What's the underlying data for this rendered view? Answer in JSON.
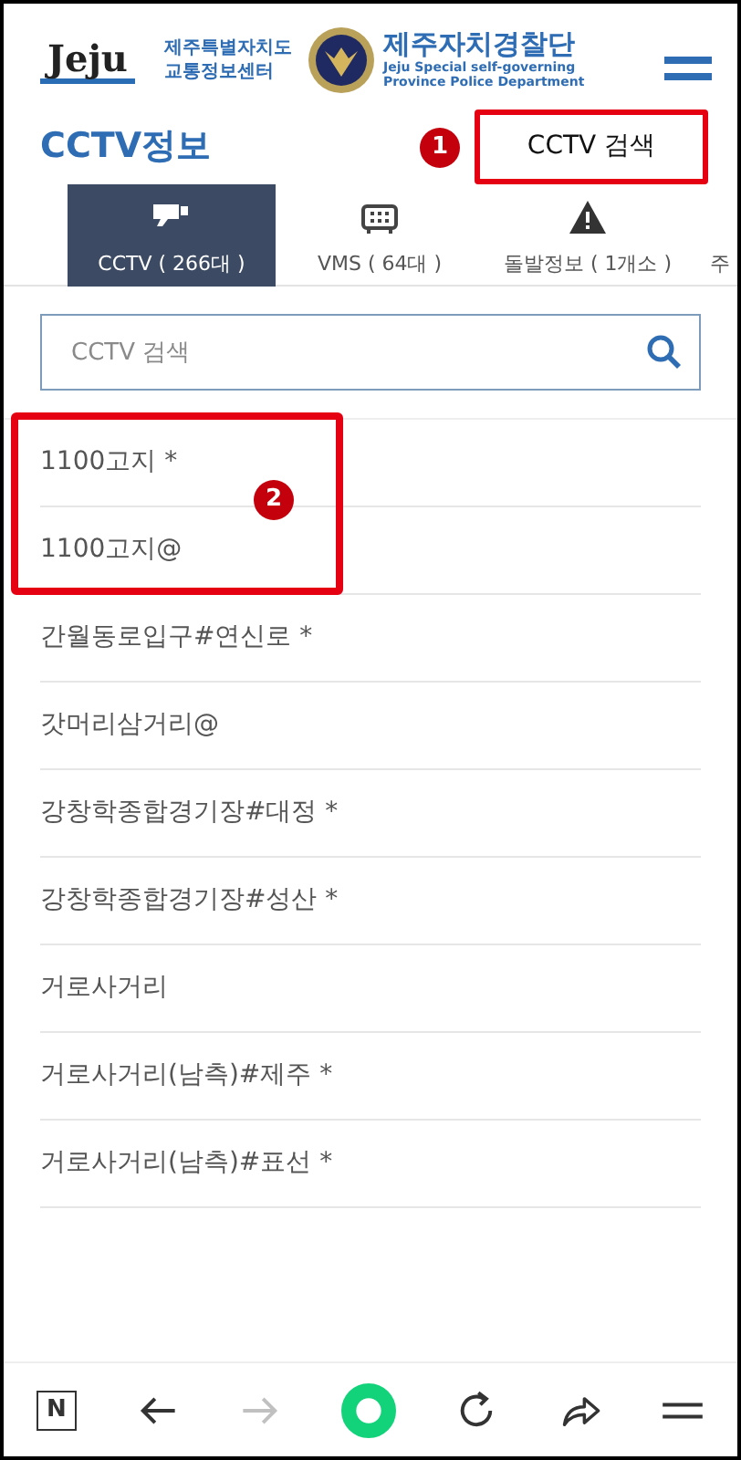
{
  "header": {
    "logo_text": "Jeju",
    "center_name": [
      "제주특별자치도",
      "교통정보센터"
    ],
    "police_name": "제주자치경찰단",
    "police_subtitle": [
      "Jeju Special self-governing",
      "Province Police Department"
    ]
  },
  "page_title": "CCTV정보",
  "search_button": {
    "label": "CCTV 검색",
    "callout": "1"
  },
  "tabs": [
    {
      "kind": "cctv",
      "label": "CCTV ( 266대 )",
      "selected": true
    },
    {
      "kind": "vms",
      "label": "VMS ( 64대 )",
      "selected": false
    },
    {
      "kind": "incident",
      "label": "돌발정보 ( 1개소 )",
      "selected": false
    },
    {
      "kind": "plain",
      "label": "주",
      "selected": false
    }
  ],
  "search": {
    "placeholder": "CCTV 검색"
  },
  "list_callout": "2",
  "cctv_list": [
    "1100고지 *",
    "1100고지@",
    "간월동로입구#연신로 *",
    "갓머리삼거리@",
    "강창학종합경기장#대정 *",
    "강창학종합경기장#성산 *",
    "거로사거리",
    "거로사거리(남측)#제주 *",
    "거로사거리(남측)#표선 *"
  ],
  "browser_bar": [
    {
      "kind": "naver",
      "label": "N",
      "disabled": false
    },
    {
      "kind": "back",
      "disabled": false
    },
    {
      "kind": "forward",
      "disabled": true
    },
    {
      "kind": "home",
      "disabled": false
    },
    {
      "kind": "reload",
      "disabled": false
    },
    {
      "kind": "share",
      "disabled": false
    },
    {
      "kind": "menu",
      "disabled": false
    }
  ]
}
